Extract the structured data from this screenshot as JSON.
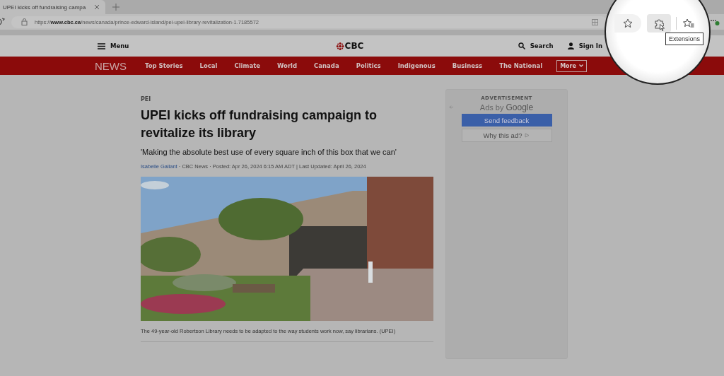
{
  "browser": {
    "tab": {
      "title": "UPEI kicks off fundraising campa",
      "selected": true
    },
    "address": "https://**www.cbc.ca**/news/canada/prince-edward-island/pei-upei-library-revitalization-1.7185572",
    "tooltip": "Extensions"
  },
  "header": {
    "menu": "Menu",
    "logo": "CBC",
    "search": "Search",
    "sign_in": "Sign In"
  },
  "nav": {
    "section": "NEWS",
    "items": [
      {
        "label": "Top Stories"
      },
      {
        "label": "Local"
      },
      {
        "label": "Climate"
      },
      {
        "label": "World"
      },
      {
        "label": "Canada"
      },
      {
        "label": "Politics"
      },
      {
        "label": "Indigenous"
      },
      {
        "label": "Business"
      },
      {
        "label": "The National"
      }
    ],
    "more": "More"
  },
  "article": {
    "category": "PEI",
    "headline": "UPEI kicks off fundraising campaign to revitalize its library",
    "subheadline": "'Making the absolute best use of every square inch of this box that we can'",
    "author": "Isabelle Gallant",
    "byline": "· CBC News · Posted: Apr 26, 2024 6:15 AM ADT | Last Updated: April 26, 2024",
    "caption": "The 49-year-old Robertson Library needs to be adapted to the way students work now, say librarians. (UPEI)"
  },
  "ad": {
    "label": "ADVERTISEMENT",
    "ads_by": "Ads by",
    "google": "Google",
    "feedback": "Send feedback",
    "why": "Why this ad?"
  }
}
